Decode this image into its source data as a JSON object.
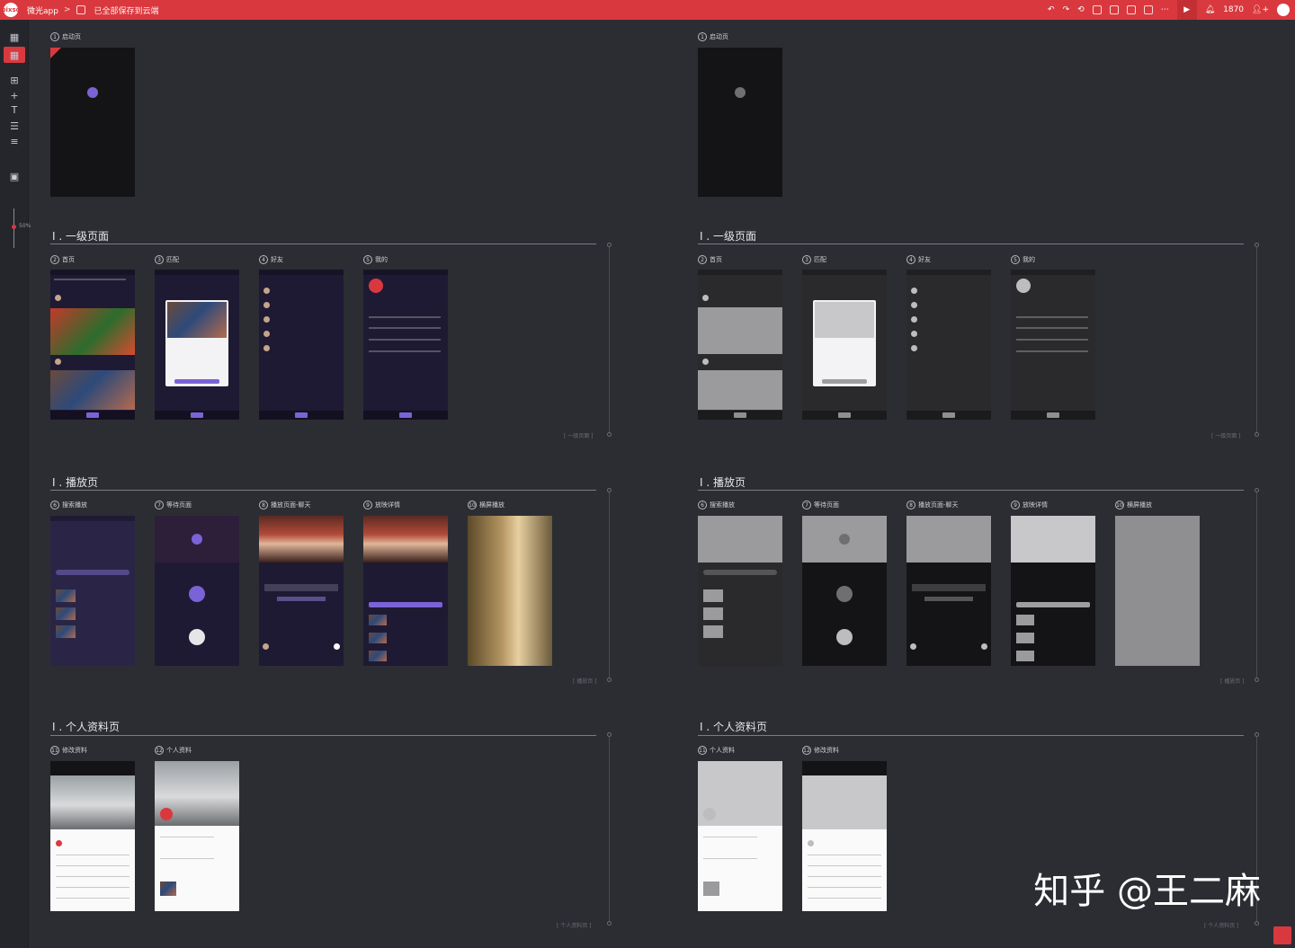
{
  "topbar": {
    "logo": "pixso",
    "project": "微光app",
    "saved": "已全部保存到云端",
    "notif_count": "1870"
  },
  "left_toolbar": {
    "zoom": "50%"
  },
  "sections": {
    "launch": "启动页",
    "level1": "一级页面",
    "play": "播放页",
    "profile": "个人资料页",
    "level1_foot": "[ 一级页面 ]",
    "play_foot": "[ 播放页 ]",
    "profile_foot": "[ 个人资料页 ]",
    "prefix": "I ."
  },
  "screens_left": {
    "s1": {
      "num": "1",
      "label": "启动页"
    },
    "s2": {
      "num": "2",
      "label": "首页"
    },
    "s3": {
      "num": "3",
      "label": "匹配"
    },
    "s4": {
      "num": "4",
      "label": "好友"
    },
    "s5": {
      "num": "5",
      "label": "我的"
    },
    "s6": {
      "num": "6",
      "label": "搜索播放"
    },
    "s7": {
      "num": "7",
      "label": "等待页面"
    },
    "s8": {
      "num": "8",
      "label": "播放页面-聊天"
    },
    "s9": {
      "num": "9",
      "label": "放映详情"
    },
    "s10": {
      "num": "10",
      "label": "横屏播放"
    },
    "s11": {
      "num": "11",
      "label": "修改资料"
    },
    "s12": {
      "num": "12",
      "label": "个人资料"
    }
  },
  "screens_right": {
    "s1": {
      "num": "1",
      "label": "启动页"
    },
    "s2": {
      "num": "2",
      "label": "首页"
    },
    "s3": {
      "num": "3",
      "label": "匹配"
    },
    "s4": {
      "num": "4",
      "label": "好友"
    },
    "s5": {
      "num": "5",
      "label": "我的"
    },
    "s6": {
      "num": "6",
      "label": "搜索播放"
    },
    "s7": {
      "num": "7",
      "label": "等待页面"
    },
    "s8": {
      "num": "8",
      "label": "播放页面-聊天"
    },
    "s9": {
      "num": "9",
      "label": "放映详情"
    },
    "s10": {
      "num": "10",
      "label": "横屏播放"
    },
    "s11": {
      "num": "11",
      "label": "个人资料"
    },
    "s12": {
      "num": "12",
      "label": "修改资料"
    }
  },
  "watermark": "知乎 @王二麻",
  "colors": {
    "accent": "#d9393e",
    "canvas": "#2c2d33",
    "purple": "#7a63d6"
  }
}
